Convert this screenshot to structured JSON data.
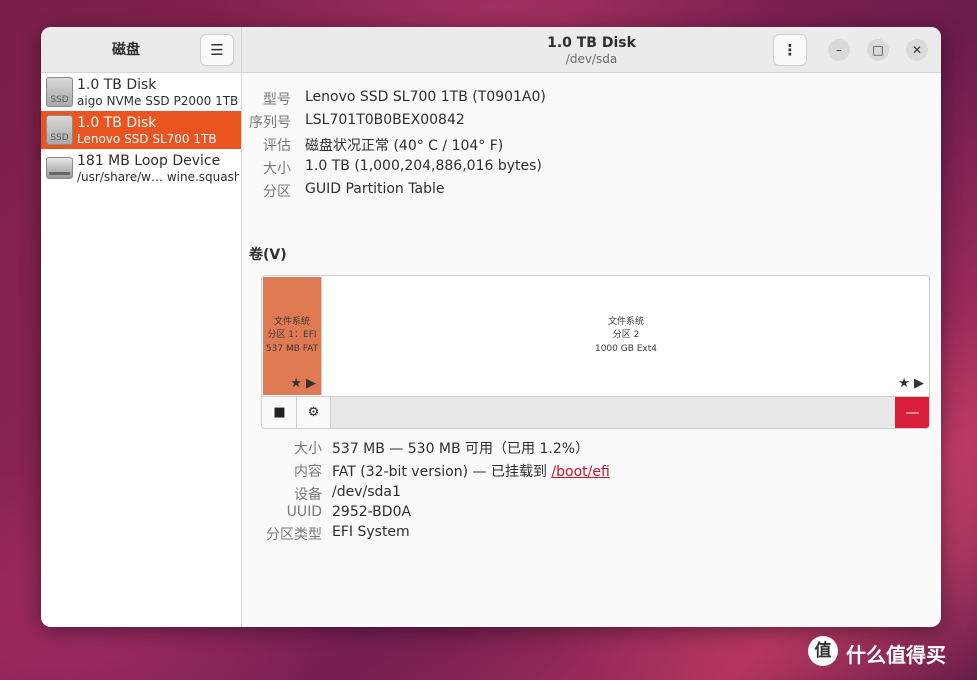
{
  "sidebar": {
    "title": "磁盘",
    "menu_icon": "☰",
    "devices": [
      {
        "name": "1.0 TB Disk",
        "sub": "aigo NVMe SSD P2000 1TB",
        "icon": "ssd-icon",
        "icon_label": "SSD",
        "selected": false
      },
      {
        "name": "1.0 TB Disk",
        "sub": "Lenovo SSD SL700 1TB",
        "icon": "ssd-icon",
        "icon_label": "SSD",
        "selected": true
      },
      {
        "name": "181 MB Loop Device",
        "sub": "/usr/share/w… wine.squashfs",
        "icon": "loop-device-icon",
        "selected": false
      }
    ]
  },
  "header": {
    "title": "1.0 TB Disk",
    "subtitle": "/dev/sda",
    "kebab_icon": "⋮",
    "minimize": "–",
    "maximize": "□",
    "close": "✕"
  },
  "disk_info": {
    "model_label": "型号",
    "model": "Lenovo SSD SL700 1TB (T0901A0)",
    "serial_label": "序列号",
    "serial": "LSL701T0B0BEX00842",
    "assessment_label": "评估",
    "assessment": "磁盘状况正常 (40° C / 104° F)",
    "size_label": "大小",
    "size": "1.0 TB (1,000,204,886,016 bytes)",
    "partitioning_label": "分区",
    "partitioning": "GUID Partition Table"
  },
  "volumes": {
    "title": "卷(V)",
    "partitions": [
      {
        "line1": "文件系统",
        "line2": "分区 1：EFI …",
        "line3": "537 MB FAT",
        "stars": "★ ▶"
      },
      {
        "line1": "文件系统",
        "line2": "分区 2",
        "line3": "1000 GB Ext4",
        "stars": "★ ▶"
      }
    ],
    "toolbar": {
      "stop_icon": "■",
      "gear_icon": "⚙",
      "delete_icon": "—"
    }
  },
  "partition_info": {
    "size_label": "大小",
    "size": "537 MB — 530 MB 可用（已用 1.2%）",
    "contents_label": "内容",
    "contents_prefix": "FAT (32-bit version) — 已挂载到 ",
    "mount_link": "/boot/efi",
    "device_label": "设备",
    "device": "/dev/sda1",
    "uuid_label": "UUID",
    "uuid": "2952-BD0A",
    "type_label": "分区类型",
    "type": "EFI System"
  },
  "watermark": {
    "logo": "值",
    "text": "什么值得买"
  },
  "colors": {
    "accent": "#e95420",
    "danger": "#d81e3a",
    "partition_selected": "#e07a52"
  }
}
